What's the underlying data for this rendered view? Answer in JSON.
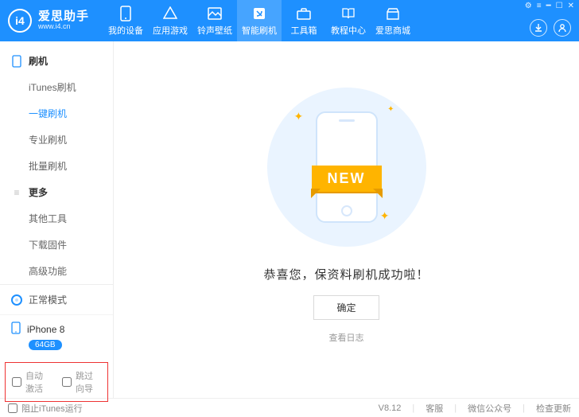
{
  "brand": {
    "title": "爱思助手",
    "subtitle": "www.i4.cn",
    "logo_text": "i4"
  },
  "top_tabs": [
    {
      "label": "我的设备"
    },
    {
      "label": "应用游戏"
    },
    {
      "label": "铃声壁纸"
    },
    {
      "label": "智能刷机"
    },
    {
      "label": "工具箱"
    },
    {
      "label": "教程中心"
    },
    {
      "label": "爱思商城"
    }
  ],
  "sidebar": {
    "group1": {
      "title": "刷机"
    },
    "items1": [
      {
        "label": "iTunes刷机"
      },
      {
        "label": "一键刷机"
      },
      {
        "label": "专业刷机"
      },
      {
        "label": "批量刷机"
      }
    ],
    "group2": {
      "title": "更多"
    },
    "items2": [
      {
        "label": "其他工具"
      },
      {
        "label": "下载固件"
      },
      {
        "label": "高级功能"
      }
    ],
    "mode_label": "正常模式",
    "device_name": "iPhone 8",
    "device_badge": "64GB",
    "checkbox_auto_activate": "自动激活",
    "checkbox_skip_guide": "跳过向导"
  },
  "main": {
    "ribbon_text": "NEW",
    "success_text": "恭喜您，保资料刷机成功啦！",
    "ok_button": "确定",
    "view_log": "查看日志"
  },
  "statusbar": {
    "block_itunes": "阻止iTunes运行",
    "version": "V8.12",
    "support": "客服",
    "wechat": "微信公众号",
    "check_update": "检查更新"
  }
}
